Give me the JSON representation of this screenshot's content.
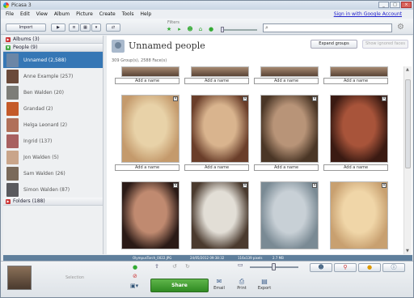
{
  "window": {
    "title": "Picasa 3"
  },
  "menu": {
    "items": [
      "File",
      "Edit",
      "View",
      "Album",
      "Picture",
      "Create",
      "Tools",
      "Help"
    ],
    "signin": "Sign in with Google Account"
  },
  "toolbar": {
    "import_label": "Import",
    "filters_label": "Filters",
    "search_placeholder": ""
  },
  "sidebar": {
    "albums_label": "Albums (3)",
    "people_label": "People (9)",
    "folders_label": "Folders (188)",
    "people": [
      {
        "label": "Unnamed (2,588)",
        "selected": true,
        "color": "#6b86a6"
      },
      {
        "label": "Anne Example (257)",
        "selected": false,
        "color": "#6a4a3a"
      },
      {
        "label": "Ben Walden (20)",
        "selected": false,
        "color": "#7d7d78"
      },
      {
        "label": "Grandad (2)",
        "selected": false,
        "color": "#c45a2a"
      },
      {
        "label": "Helga Leonard (2)",
        "selected": false,
        "color": "#b0705a"
      },
      {
        "label": "Ingrid (137)",
        "selected": false,
        "color": "#a86060"
      },
      {
        "label": "Jon Walden (5)",
        "selected": false,
        "color": "#c9a58a"
      },
      {
        "label": "Sam Walden (26)",
        "selected": false,
        "color": "#7a6a5a"
      },
      {
        "label": "Simon Walden (87)",
        "selected": false,
        "color": "#5a5a5e"
      }
    ]
  },
  "main": {
    "title": "Unnamed people",
    "count": "309 Group(s), 2588 Face(s)",
    "expand_label": "Expand groups",
    "ignore_label": "Show ignored faces",
    "add_name_label": "Add a name",
    "faces": [
      {
        "colors": [
          "#e8d2a8",
          "#c49a6c"
        ]
      },
      {
        "colors": [
          "#d9b48e",
          "#6a3e2a"
        ]
      },
      {
        "colors": [
          "#b89478",
          "#4a3626"
        ]
      },
      {
        "colors": [
          "#a8543a",
          "#3a1a12"
        ]
      },
      {
        "colors": [
          "#c08a70",
          "#2a1a16"
        ]
      },
      {
        "colors": [
          "#e2ded6",
          "#4a3a2e"
        ]
      },
      {
        "colors": [
          "#c8d0d6",
          "#7a8a94"
        ]
      },
      {
        "colors": [
          "#f0d6a8",
          "#c8a070"
        ]
      }
    ]
  },
  "status": {
    "file": "OlympusTorch_0022.JPG",
    "date": "24/05/2012 09:38:32",
    "dims": "116x139 pixels",
    "size": "2.7 MB"
  },
  "tray": {
    "selection_label": "Selection",
    "share_label": "Share",
    "email_label": "Email",
    "print_label": "Print",
    "export_label": "Export"
  }
}
